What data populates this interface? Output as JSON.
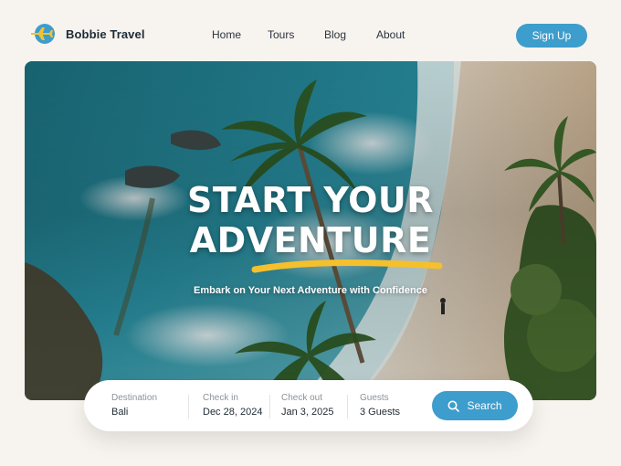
{
  "brand": {
    "name": "Bobbie Travel",
    "logo_icon": "airplane-icon",
    "logo_color": "#3d9dcc",
    "plane_color": "#f2c230"
  },
  "nav": {
    "links": [
      {
        "label": "Home"
      },
      {
        "label": "Tours"
      },
      {
        "label": "Blog"
      },
      {
        "label": "About"
      }
    ],
    "signup_label": "Sign Up"
  },
  "hero": {
    "title_line1": "START YOUR",
    "title_line2": "ADVENTURE",
    "subtitle": "Embark on Your Next Adventure with Confidence",
    "underline_color": "#f5c02c",
    "image_description_colors": {
      "sea": "#1b7f8f",
      "sand": "#d8c7ae",
      "foliage": "#3d5f2a"
    }
  },
  "search": {
    "fields": [
      {
        "label": "Destination",
        "value": "Bali"
      },
      {
        "label": "Check in",
        "value": "Dec 28, 2024"
      },
      {
        "label": "Check out",
        "value": "Jan 3, 2025"
      },
      {
        "label": "Guests",
        "value": "3 Guests"
      }
    ],
    "button_label": "Search",
    "button_icon": "search-icon"
  },
  "colors": {
    "accent": "#3d9dcc",
    "page_background": "#f7f3ee"
  }
}
